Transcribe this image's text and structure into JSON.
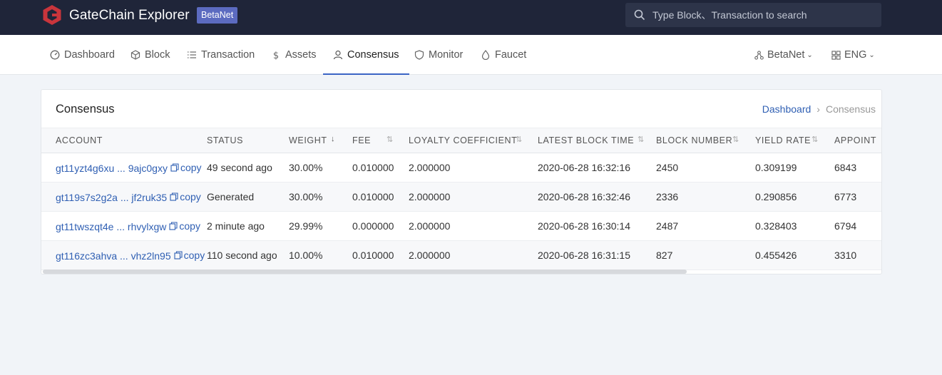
{
  "header": {
    "brand": "GateChain Explorer",
    "badge": "BetaNet",
    "search_placeholder": "Type Block、Transaction to search",
    "accent_color": "#c9353c"
  },
  "nav": {
    "items": [
      {
        "label": "Dashboard",
        "icon": "dashboard-icon"
      },
      {
        "label": "Block",
        "icon": "cube-icon"
      },
      {
        "label": "Transaction",
        "icon": "list-icon"
      },
      {
        "label": "Assets",
        "icon": "dollar-icon"
      },
      {
        "label": "Consensus",
        "icon": "user-icon",
        "active": true
      },
      {
        "label": "Monitor",
        "icon": "shield-icon"
      },
      {
        "label": "Faucet",
        "icon": "drop-icon"
      }
    ],
    "network": "BetaNet",
    "language": "ENG"
  },
  "card": {
    "title": "Consensus",
    "breadcrumb": {
      "home": "Dashboard",
      "current": "Consensus"
    }
  },
  "table": {
    "columns": [
      "ACCOUNT",
      "STATUS",
      "WEIGHT",
      "FEE",
      "LOYALTY COEFFICIENT",
      "LATEST BLOCK TIME",
      "BLOCK NUMBER",
      "YIELD RATE",
      "APPOINT"
    ],
    "copy_label": "copy",
    "rows": [
      {
        "account": "gt11yzt4g6xu ... 9ajc0gxy",
        "status": "49 second ago",
        "weight": "30.00%",
        "fee": "0.010000",
        "loyalty": "2.000000",
        "time": "2020-06-28 16:32:16",
        "block": "2450",
        "yield": "0.309199",
        "appoint": "6843"
      },
      {
        "account": "gt119s7s2g2a ... jf2ruk35",
        "status": "Generated",
        "weight": "30.00%",
        "fee": "0.010000",
        "loyalty": "2.000000",
        "time": "2020-06-28 16:32:46",
        "block": "2336",
        "yield": "0.290856",
        "appoint": "6773"
      },
      {
        "account": "gt11twszqt4e ... rhvylxgw",
        "status": "2 minute ago",
        "weight": "29.99%",
        "fee": "0.000000",
        "loyalty": "2.000000",
        "time": "2020-06-28 16:30:14",
        "block": "2487",
        "yield": "0.328403",
        "appoint": "6794"
      },
      {
        "account": "gt116zc3ahva ... vhz2ln95",
        "status": "110 second ago",
        "weight": "10.00%",
        "fee": "0.010000",
        "loyalty": "2.000000",
        "time": "2020-06-28 16:31:15",
        "block": "827",
        "yield": "0.455426",
        "appoint": "3310"
      }
    ]
  }
}
